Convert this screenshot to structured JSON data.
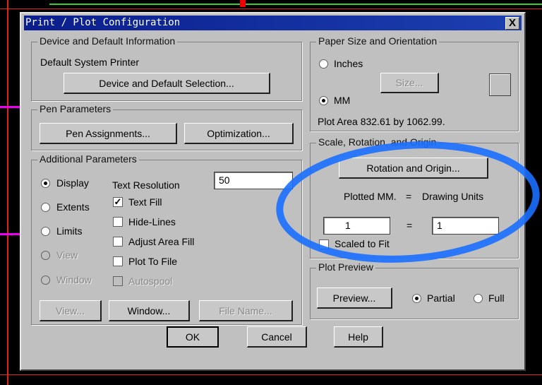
{
  "dialog": {
    "title": "Print / Plot Configuration",
    "close_label": "X"
  },
  "device": {
    "group_label": "Device and Default Information",
    "printer": "Default System Printer",
    "selection_button": "Device and Default Selection..."
  },
  "pen": {
    "group_label": "Pen Parameters",
    "assignments_button": "Pen Assignments...",
    "optimization_button": "Optimization..."
  },
  "additional": {
    "group_label": "Additional Parameters",
    "radios": [
      {
        "label": "Display",
        "checked": true,
        "enabled": true
      },
      {
        "label": "Extents",
        "checked": false,
        "enabled": true
      },
      {
        "label": "Limits",
        "checked": false,
        "enabled": true
      },
      {
        "label": "View",
        "checked": false,
        "enabled": false
      },
      {
        "label": "Window",
        "checked": false,
        "enabled": false
      }
    ],
    "text_resolution_label": "Text Resolution",
    "text_resolution_value": "50",
    "checkboxes": [
      {
        "label": "Text Fill",
        "checked": true,
        "enabled": true
      },
      {
        "label": "Hide-Lines",
        "checked": false,
        "enabled": true
      },
      {
        "label": "Adjust Area Fill",
        "checked": false,
        "enabled": true
      },
      {
        "label": "Plot To File",
        "checked": false,
        "enabled": true
      },
      {
        "label": "Autospool",
        "checked": false,
        "enabled": false
      }
    ],
    "view_button": "View...",
    "window_button": "Window...",
    "file_name_button": "File Name..."
  },
  "paper": {
    "group_label": "Paper Size and Orientation",
    "inches_label": "Inches",
    "mm_label": "MM",
    "size_button": "Size...",
    "plot_area": "Plot Area 832.61 by 1062.99."
  },
  "scale": {
    "group_label": "Scale, Rotation, and Origin",
    "rotation_button": "Rotation and Origin...",
    "plotted_label": "Plotted MM.",
    "equals": "=",
    "drawing_units_label": "Drawing Units",
    "plotted_value": "1",
    "drawing_value": "1",
    "scaled_to_fit_label": "Scaled to Fit"
  },
  "preview": {
    "group_label": "Plot Preview",
    "preview_button": "Preview...",
    "partial_label": "Partial",
    "full_label": "Full"
  },
  "footer": {
    "ok": "OK",
    "cancel": "Cancel",
    "help": "Help"
  },
  "colors": {
    "annotation": "#1a6fff",
    "titlebar": "#0a1e8c"
  }
}
